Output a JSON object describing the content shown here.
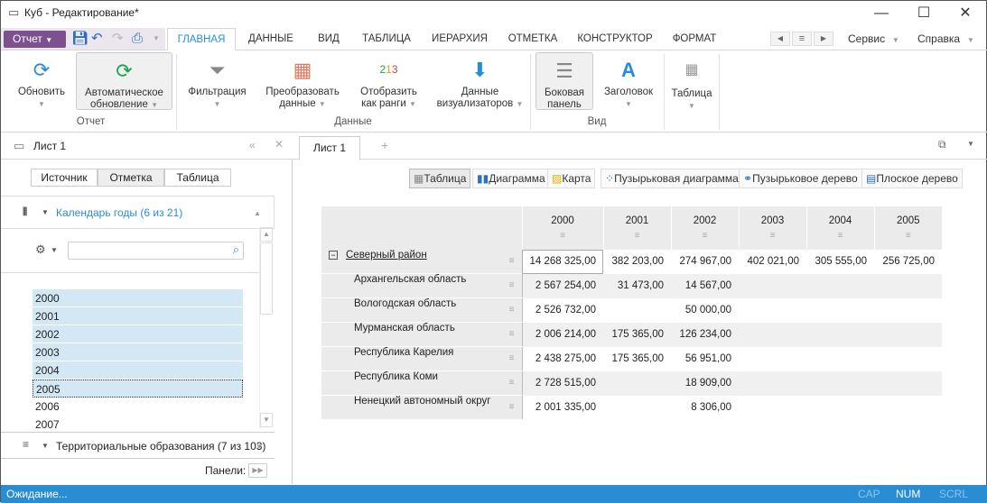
{
  "window": {
    "title": "Куб - Редактирование*",
    "minimize": "—",
    "maximize": "☐",
    "close": "✕"
  },
  "quick": {
    "report_label": "Отчет"
  },
  "tabs": [
    "ГЛАВНАЯ",
    "ДАННЫЕ",
    "ВИД",
    "ТАБЛИЦА",
    "ИЕРАРХИЯ",
    "ОТМЕТКА",
    "КОНСТРУКТОР",
    "ФОРМАТ"
  ],
  "menus": {
    "service": "Сервис",
    "help": "Справка"
  },
  "ribbon": {
    "refresh": "Обновить",
    "auto_refresh_1": "Автоматическое",
    "auto_refresh_2": "обновление",
    "filter": "Фильтрация",
    "transform_1": "Преобразовать",
    "transform_2": "данные",
    "ranks_1": "Отобразить",
    "ranks_2": "как ранги",
    "vis_1": "Данные",
    "vis_2": "визуализаторов",
    "side_1": "Боковая",
    "side_2": "панель",
    "heading": "Заголовок",
    "table": "Таблица",
    "group_report": "Отчет",
    "group_data": "Данные",
    "group_view": "Вид"
  },
  "sheet": {
    "panel_tab": "Лист 1",
    "tab": "Лист 1",
    "add": "+"
  },
  "left": {
    "segments": [
      "Источник",
      "Отметка",
      "Таблица"
    ],
    "dim1": "Календарь годы (6 из 21)",
    "years": [
      {
        "y": "2000",
        "sel": true
      },
      {
        "y": "2001",
        "sel": true
      },
      {
        "y": "2002",
        "sel": true
      },
      {
        "y": "2003",
        "sel": true
      },
      {
        "y": "2004",
        "sel": true
      },
      {
        "y": "2005",
        "sel": true
      },
      {
        "y": "2006",
        "sel": false
      },
      {
        "y": "2007",
        "sel": false
      }
    ],
    "dim2": "Территориальные образования (7 из 103)",
    "panels_label": "Панели:"
  },
  "views": [
    "Таблица",
    "Диаграмма",
    "Карта",
    "Пузырьковая диаграмма",
    "Пузырьковое дерево",
    "Плоское дерево"
  ],
  "grid": {
    "columns": [
      "2000",
      "2001",
      "2002",
      "2003",
      "2004",
      "2005"
    ],
    "rows": [
      {
        "name": "Северный район",
        "values": [
          "14 268 325,00",
          "382 203,00",
          "274 967,00",
          "402 021,00",
          "305 555,00",
          "256 725,00"
        ]
      },
      {
        "name": "Архангельская область",
        "values": [
          "2 567 254,00",
          "31 473,00",
          "14 567,00",
          "",
          "",
          ""
        ]
      },
      {
        "name": "Вологодская область",
        "values": [
          "2 526 732,00",
          "",
          "50 000,00",
          "",
          "",
          ""
        ]
      },
      {
        "name": "Мурманская область",
        "values": [
          "2 006 214,00",
          "175 365,00",
          "126 234,00",
          "",
          "",
          ""
        ]
      },
      {
        "name": "Республика Карелия",
        "values": [
          "2 438 275,00",
          "175 365,00",
          "56 951,00",
          "",
          "",
          ""
        ]
      },
      {
        "name": "Республика Коми",
        "values": [
          "2 728 515,00",
          "",
          "18 909,00",
          "",
          "",
          ""
        ]
      },
      {
        "name": "Ненецкий автономный округ",
        "values": [
          "2 001 335,00",
          "",
          "8 306,00",
          "",
          "",
          ""
        ]
      }
    ]
  },
  "status": {
    "text": "Ожидание...",
    "cap": "CAP",
    "num": "NUM",
    "scrl": "SCRL"
  }
}
